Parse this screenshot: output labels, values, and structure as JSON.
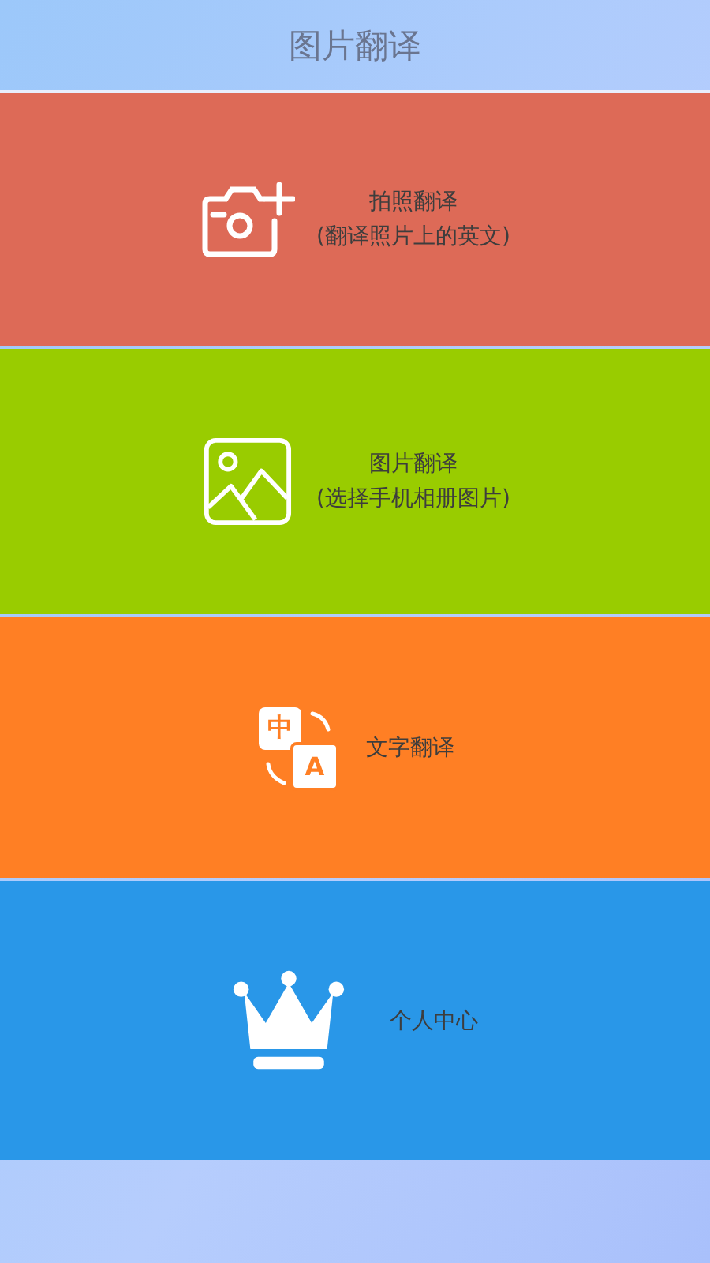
{
  "header": {
    "title": "图片翻译"
  },
  "tiles": [
    {
      "kind": "camera",
      "color": "#dd6a57",
      "lines": [
        "拍照翻译",
        "(翻译照片上的英文)"
      ]
    },
    {
      "kind": "picture",
      "color": "#99cc00",
      "lines": [
        "图片翻译",
        "(选择手机相册图片)"
      ]
    },
    {
      "kind": "translate",
      "color": "#ff7f24",
      "lines": [
        "文字翻译"
      ],
      "icon_labels": [
        "中",
        "A"
      ]
    },
    {
      "kind": "crown",
      "color": "#2997e8",
      "lines": [
        "个人中心"
      ]
    }
  ]
}
